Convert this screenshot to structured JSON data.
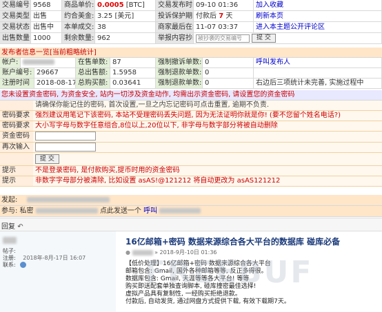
{
  "trade": {
    "rows": [
      [
        "交易编号:",
        "9568",
        "商品单价:",
        "0.0005",
        "[BTC]",
        "交易发布时间:",
        "09-10 01:36",
        "加入收藏"
      ],
      [
        "交易类型:",
        "出售",
        "约合美金:",
        "3.25",
        "[美元]",
        "投诉保护期限:",
        "付款后",
        "7",
        "天",
        "刷新本页"
      ],
      [
        "交易状态:",
        "出售中",
        "本单成交:",
        "38",
        "商家最后在线:",
        "11-07 03:37",
        "进入本主题公开评论区"
      ],
      [
        "出售数量:",
        "1000",
        "剩余数量:",
        "962",
        "举报内容抄袭:",
        "被抄袭的交易编号",
        "提 交"
      ]
    ]
  },
  "publisher": {
    "title": "发布者信息一览[当前粗略统计]",
    "rows": [
      [
        "帐户:",
        "在售单数:",
        "87",
        "强制撤诉单数:",
        "0",
        "呼叫发布人"
      ],
      [
        "账户编号:",
        "29667",
        "总出售额:",
        "1.5958",
        "强制退款单数:",
        "0"
      ],
      [
        "注册时间",
        "2018-08-17",
        "总购买额:",
        "0.03641",
        "强制退款单数:",
        "0",
        "右边后三项统计未完善, 实施过程中"
      ]
    ]
  },
  "password": {
    "warning": "您未设置资金密码, 为资金安全, 站内一切涉及资金动作, 均需出示资金密码, 请设置您的资金密码",
    "rows": [
      {
        "label": "",
        "text": "请确保你能记住的密码, 首次设置,一旦之内忘记密码可点击重置, 逾期不负责."
      },
      {
        "label": "密码要求",
        "text": "强烈建议用笔记下该密码, 本站不受理密码丢失问题, 因为无法证明你就是你! (要不您留个姓名电话?)"
      },
      {
        "label": "密码要求",
        "text": "大小写字母与数字任意组合,8位以上,20位以下, 非字母与数字部分将被自动删除"
      },
      {
        "label": "资金密码",
        "text": ""
      },
      {
        "label": "再次输入",
        "text": ""
      }
    ],
    "submit": "提 交",
    "tips": [
      {
        "label": "提示",
        "text": "不是登录密码, 是付款购买,提币时用的资金密码"
      },
      {
        "label": "提示",
        "text": "非数字字母部分被清除, 比如设置 asAS!@121212 将自动更改为 asAS121212"
      }
    ]
  },
  "bottom": {
    "row1_label": "发起:",
    "row2_label": "参与: 私密",
    "row2_text": "点此发送一个",
    "row2_link": "呼叫"
  },
  "reply": {
    "button": "回复"
  },
  "post": {
    "title": "16亿邮箱+密码  数据来源综合各大平台的数据库  碰库必备",
    "meta": "» 2018-9月-10日 01:36",
    "lines": [
      "【低价处理】16亿邮箱+密码  数据来源综合各大平台",
      "邮箱包含: Gmail, 国外各种邮箱等等, 反正多得很。",
      "数据库包含: Gmail, 天涯等等各大平台! 等等",
      "购买即送配套单独查询脚本, 碰库撞密最佳选择!",
      "虚拟产品具有复制性, 一经购买拒绝退款。",
      "付款后, 自动发货, 通过网盘方式提供下载, 有效下载期7天。"
    ]
  },
  "leftcol": {
    "label1": "帖子:",
    "label2": "注册:",
    "label3": "联系:",
    "date": "2018年-8月-17日 16:07"
  },
  "watermark": "FREEBUF"
}
